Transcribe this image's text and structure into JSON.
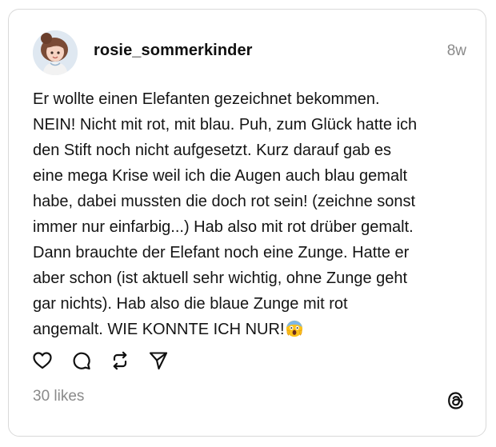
{
  "post": {
    "author": {
      "username": "rosie_sommerkinder",
      "avatar_icon": "avatar-illustration-icon"
    },
    "timestamp": "8w",
    "text": "Er wollte einen Elefanten gezeichnet bekommen.\nNEIN! Nicht mit rot, mit blau. Puh, zum Glück hatte ich\nden Stift noch nicht aufgesetzt. Kurz darauf gab es\neine mega Krise weil ich die Augen auch blau gemalt\nhabe, dabei mussten die doch rot sein! (zeichne sonst\nimmer nur einfarbig...) Hab also mit rot drüber gemalt.\nDann brauchte der Elefant noch eine Zunge. Hatte er\naber schon (ist aktuell sehr wichtig, ohne Zunge geht\ngar nichts). Hab also die blaue Zunge mit rot\nangemalt. WIE KONNTE ICH NUR!",
    "text_emoji": "screaming-face-emoji",
    "likes": "30 likes"
  },
  "actions": [
    {
      "name": "like",
      "icon": "heart-icon"
    },
    {
      "name": "reply",
      "icon": "comment-icon"
    },
    {
      "name": "repost",
      "icon": "repost-icon"
    },
    {
      "name": "share",
      "icon": "send-icon"
    }
  ],
  "brand": {
    "logo_icon": "threads-logo-icon"
  },
  "colors": {
    "text": "#101010",
    "muted": "#8a8a8a",
    "border": "#d9d9d9"
  }
}
